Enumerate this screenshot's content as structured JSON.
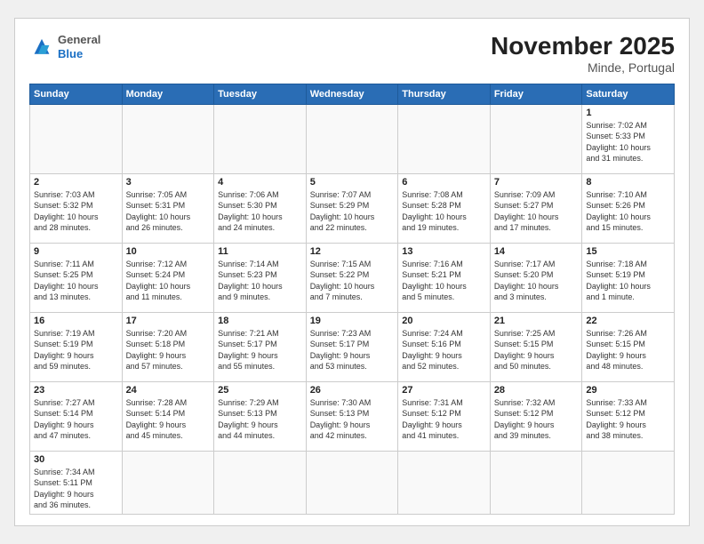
{
  "header": {
    "logo_general": "General",
    "logo_blue": "Blue",
    "month": "November 2025",
    "location": "Minde, Portugal"
  },
  "weekdays": [
    "Sunday",
    "Monday",
    "Tuesday",
    "Wednesday",
    "Thursday",
    "Friday",
    "Saturday"
  ],
  "days": [
    {
      "date": null,
      "info": null
    },
    {
      "date": null,
      "info": null
    },
    {
      "date": null,
      "info": null
    },
    {
      "date": null,
      "info": null
    },
    {
      "date": null,
      "info": null
    },
    {
      "date": null,
      "info": null
    },
    {
      "date": "1",
      "info": "Sunrise: 7:02 AM\nSunset: 5:33 PM\nDaylight: 10 hours\nand 31 minutes."
    },
    {
      "date": "2",
      "info": "Sunrise: 7:03 AM\nSunset: 5:32 PM\nDaylight: 10 hours\nand 28 minutes."
    },
    {
      "date": "3",
      "info": "Sunrise: 7:05 AM\nSunset: 5:31 PM\nDaylight: 10 hours\nand 26 minutes."
    },
    {
      "date": "4",
      "info": "Sunrise: 7:06 AM\nSunset: 5:30 PM\nDaylight: 10 hours\nand 24 minutes."
    },
    {
      "date": "5",
      "info": "Sunrise: 7:07 AM\nSunset: 5:29 PM\nDaylight: 10 hours\nand 22 minutes."
    },
    {
      "date": "6",
      "info": "Sunrise: 7:08 AM\nSunset: 5:28 PM\nDaylight: 10 hours\nand 19 minutes."
    },
    {
      "date": "7",
      "info": "Sunrise: 7:09 AM\nSunset: 5:27 PM\nDaylight: 10 hours\nand 17 minutes."
    },
    {
      "date": "8",
      "info": "Sunrise: 7:10 AM\nSunset: 5:26 PM\nDaylight: 10 hours\nand 15 minutes."
    },
    {
      "date": "9",
      "info": "Sunrise: 7:11 AM\nSunset: 5:25 PM\nDaylight: 10 hours\nand 13 minutes."
    },
    {
      "date": "10",
      "info": "Sunrise: 7:12 AM\nSunset: 5:24 PM\nDaylight: 10 hours\nand 11 minutes."
    },
    {
      "date": "11",
      "info": "Sunrise: 7:14 AM\nSunset: 5:23 PM\nDaylight: 10 hours\nand 9 minutes."
    },
    {
      "date": "12",
      "info": "Sunrise: 7:15 AM\nSunset: 5:22 PM\nDaylight: 10 hours\nand 7 minutes."
    },
    {
      "date": "13",
      "info": "Sunrise: 7:16 AM\nSunset: 5:21 PM\nDaylight: 10 hours\nand 5 minutes."
    },
    {
      "date": "14",
      "info": "Sunrise: 7:17 AM\nSunset: 5:20 PM\nDaylight: 10 hours\nand 3 minutes."
    },
    {
      "date": "15",
      "info": "Sunrise: 7:18 AM\nSunset: 5:19 PM\nDaylight: 10 hours\nand 1 minute."
    },
    {
      "date": "16",
      "info": "Sunrise: 7:19 AM\nSunset: 5:19 PM\nDaylight: 9 hours\nand 59 minutes."
    },
    {
      "date": "17",
      "info": "Sunrise: 7:20 AM\nSunset: 5:18 PM\nDaylight: 9 hours\nand 57 minutes."
    },
    {
      "date": "18",
      "info": "Sunrise: 7:21 AM\nSunset: 5:17 PM\nDaylight: 9 hours\nand 55 minutes."
    },
    {
      "date": "19",
      "info": "Sunrise: 7:23 AM\nSunset: 5:17 PM\nDaylight: 9 hours\nand 53 minutes."
    },
    {
      "date": "20",
      "info": "Sunrise: 7:24 AM\nSunset: 5:16 PM\nDaylight: 9 hours\nand 52 minutes."
    },
    {
      "date": "21",
      "info": "Sunrise: 7:25 AM\nSunset: 5:15 PM\nDaylight: 9 hours\nand 50 minutes."
    },
    {
      "date": "22",
      "info": "Sunrise: 7:26 AM\nSunset: 5:15 PM\nDaylight: 9 hours\nand 48 minutes."
    },
    {
      "date": "23",
      "info": "Sunrise: 7:27 AM\nSunset: 5:14 PM\nDaylight: 9 hours\nand 47 minutes."
    },
    {
      "date": "24",
      "info": "Sunrise: 7:28 AM\nSunset: 5:14 PM\nDaylight: 9 hours\nand 45 minutes."
    },
    {
      "date": "25",
      "info": "Sunrise: 7:29 AM\nSunset: 5:13 PM\nDaylight: 9 hours\nand 44 minutes."
    },
    {
      "date": "26",
      "info": "Sunrise: 7:30 AM\nSunset: 5:13 PM\nDaylight: 9 hours\nand 42 minutes."
    },
    {
      "date": "27",
      "info": "Sunrise: 7:31 AM\nSunset: 5:12 PM\nDaylight: 9 hours\nand 41 minutes."
    },
    {
      "date": "28",
      "info": "Sunrise: 7:32 AM\nSunset: 5:12 PM\nDaylight: 9 hours\nand 39 minutes."
    },
    {
      "date": "29",
      "info": "Sunrise: 7:33 AM\nSunset: 5:12 PM\nDaylight: 9 hours\nand 38 minutes."
    },
    {
      "date": "30",
      "info": "Sunrise: 7:34 AM\nSunset: 5:11 PM\nDaylight: 9 hours\nand 36 minutes."
    },
    {
      "date": null,
      "info": null
    },
    {
      "date": null,
      "info": null
    },
    {
      "date": null,
      "info": null
    },
    {
      "date": null,
      "info": null
    },
    {
      "date": null,
      "info": null
    },
    {
      "date": null,
      "info": null
    }
  ]
}
